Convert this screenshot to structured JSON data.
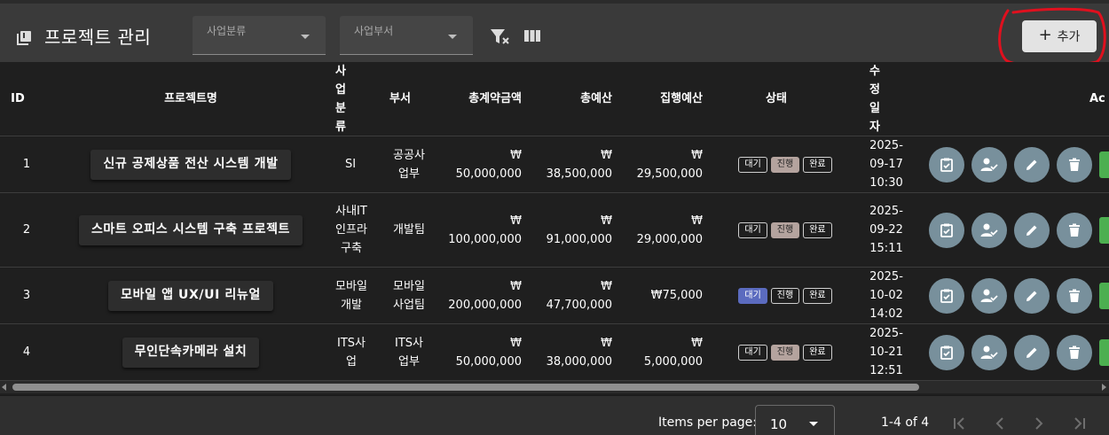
{
  "toolbar": {
    "title": "프로젝트 관리",
    "filter_category": {
      "placeholder": "사업분류"
    },
    "filter_department": {
      "placeholder": "사업부서"
    },
    "add_label": "추가"
  },
  "table": {
    "headers": {
      "id": "ID",
      "name": "프로젝트명",
      "category": "사업분류",
      "department": "부서",
      "contract": "총계약금액",
      "budget": "총예산",
      "exec": "집행예산",
      "status": "상태",
      "modified": "수정일자",
      "actions": "Ac"
    },
    "status_labels": {
      "waiting": "대기",
      "progress": "진행",
      "done": "완료"
    },
    "rows": [
      {
        "id": "1",
        "name": "신규 공제상품 전산 시스템 개발",
        "category": "SI",
        "department": "공공사업부",
        "contract_cur": "₩",
        "contract_amt": "50,000,000",
        "budget_cur": "₩",
        "budget_amt": "38,500,000",
        "exec_cur": "₩",
        "exec_amt": "29,500,000",
        "status": "진행",
        "date": "2025-",
        "date2": "09-17",
        "time": "10:30"
      },
      {
        "id": "2",
        "name": "스마트 오피스 시스템 구축 프로젝트",
        "category": "사내IT인프라구축",
        "department": "개발팀",
        "contract_cur": "₩",
        "contract_amt": "100,000,000",
        "budget_cur": "₩",
        "budget_amt": "91,000,000",
        "exec_cur": "₩",
        "exec_amt": "29,000,000",
        "status": "진행",
        "date": "2025-",
        "date2": "09-22",
        "time": "15:11"
      },
      {
        "id": "3",
        "name": "모바일 앱 UX/UI 리뉴얼",
        "category": "모바일개발",
        "department": "모바일사업팀",
        "contract_cur": "₩",
        "contract_amt": "200,000,000",
        "budget_cur": "₩",
        "budget_amt": "47,700,000",
        "exec_cur": "",
        "exec_amt": "₩75,000",
        "status": "대기",
        "date": "2025-",
        "date2": "10-02",
        "time": "14:02"
      },
      {
        "id": "4",
        "name": "무인단속카메라 설치",
        "category": "ITS사업",
        "department": "ITS사업부",
        "contract_cur": "₩",
        "contract_amt": "50,000,000",
        "budget_cur": "₩",
        "budget_amt": "38,000,000",
        "exec_cur": "₩",
        "exec_amt": "5,000,000",
        "status": "진행",
        "date": "2025-",
        "date2": "10-21",
        "time": "12:51"
      }
    ]
  },
  "paginator": {
    "items_per_page_label": "Items per page:",
    "page_size": "10",
    "range": "1-4 of 4"
  },
  "colors": {
    "action_button": "#78909c",
    "status_progress": "#b4a39e",
    "status_waiting": "#5b6bbf",
    "annotation_circle": "#e0101e"
  }
}
